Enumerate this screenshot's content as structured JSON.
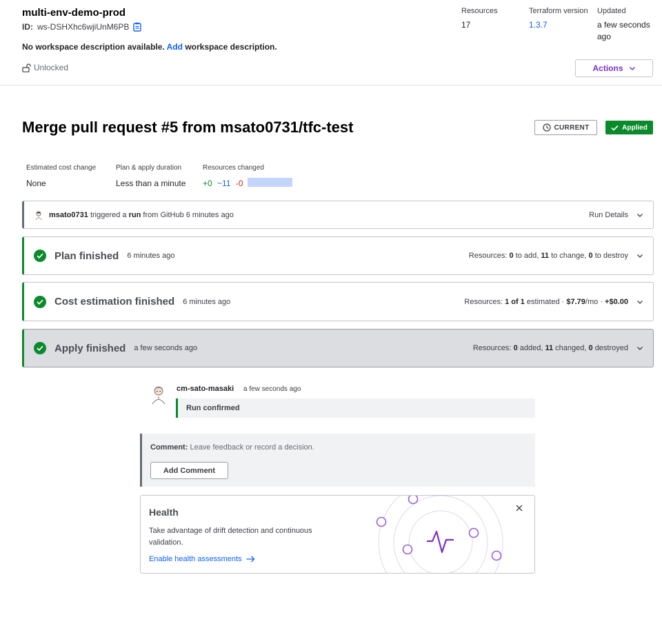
{
  "workspace": {
    "name": "multi-env-demo-prod",
    "id_label": "ID:",
    "id_value": "ws-DSHXhc6wjiUnM6PB",
    "desc_prefix": "No workspace description available.",
    "desc_link": "Add",
    "desc_suffix": "workspace description.",
    "lock_status": "Unlocked"
  },
  "meta": {
    "resources_label": "Resources",
    "resources_value": "17",
    "tf_label": "Terraform version",
    "tf_value": "1.3.7",
    "updated_label": "Updated",
    "updated_value": "a few seconds ago"
  },
  "actions": {
    "label": "Actions"
  },
  "run": {
    "title": "Merge pull request #5 from msato0731/tfc-test",
    "current_label": "CURRENT",
    "applied_label": "Applied"
  },
  "stats": {
    "cost_label": "Estimated cost change",
    "cost_value": "None",
    "duration_label": "Plan & apply duration",
    "duration_value": "Less than a minute",
    "changed_label": "Resources changed",
    "added": "+0",
    "changed": "~11",
    "destroyed": "-0"
  },
  "trigger": {
    "user": "msato0731",
    "text1": "triggered a",
    "run_word": "run",
    "text2": "from GitHub 6 minutes ago",
    "details": "Run Details"
  },
  "plan": {
    "title": "Plan finished",
    "time": "6 minutes ago",
    "r_label": "Resources:",
    "add_n": "0",
    "add_t": "to add,",
    "change_n": "11",
    "change_t": "to change,",
    "destroy_n": "0",
    "destroy_t": "to destroy"
  },
  "cost": {
    "title": "Cost estimation finished",
    "time": "6 minutes ago",
    "r_label": "Resources:",
    "est_n": "1 of 1",
    "est_t": "estimated ·",
    "monthly": "$7.79",
    "mo": "/mo ·",
    "delta": "+$0.00"
  },
  "apply": {
    "title": "Apply finished",
    "time": "a few seconds ago",
    "r_label": "Resources:",
    "added_n": "0",
    "added_t": "added,",
    "changed_n": "11",
    "changed_t": "changed,",
    "destroyed_n": "0",
    "destroyed_t": "destroyed"
  },
  "confirm": {
    "user": "cm-sato-masaki",
    "time": "a few seconds ago",
    "message": "Run confirmed"
  },
  "comment": {
    "label": "Comment:",
    "placeholder": "Leave feedback or record a decision.",
    "button": "Add Comment"
  },
  "health": {
    "title": "Health",
    "desc": "Take advantage of drift detection and continuous validation.",
    "link": "Enable health assessments"
  },
  "colors": {
    "success": "#0b8a2c",
    "link": "#1060ff",
    "accent": "#7b2fc8"
  }
}
